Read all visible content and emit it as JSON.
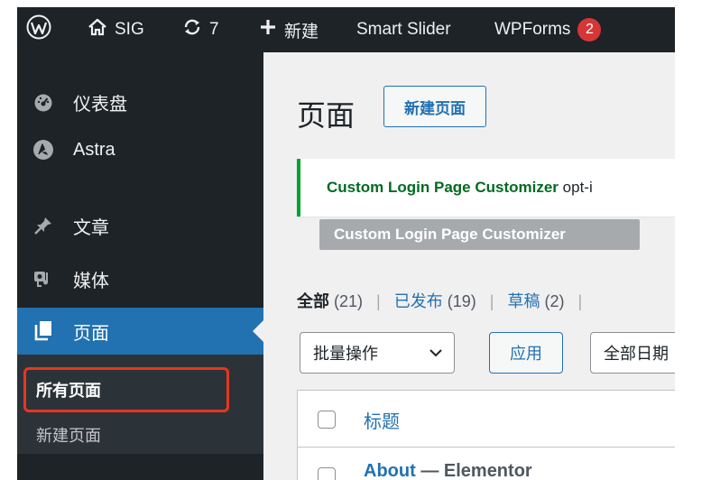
{
  "admin_bar": {
    "site_name": "SIG",
    "updates_count": "7",
    "new_label": "新建",
    "smart_slider_label": "Smart Slider",
    "wpforms_label": "WPForms",
    "wpforms_badge": "2"
  },
  "sidebar": {
    "dashboard": "仪表盘",
    "astra": "Astra",
    "posts": "文章",
    "media": "媒体",
    "pages": "页面",
    "submenu": {
      "all_pages": "所有页面",
      "add_new": "新建页面"
    }
  },
  "main": {
    "page_title": "页面",
    "add_new_button": "新建页面",
    "notice": {
      "plugin_name": "Custom Login Page Customizer",
      "text": "opt-i"
    },
    "notice_button": "Custom Login Page Customizer",
    "filters": {
      "all_label": "全部",
      "all_count": "(21)",
      "published_label": "已发布",
      "published_count": "(19)",
      "draft_label": "草稿",
      "draft_count": "(2)"
    },
    "bulk_actions": "批量操作",
    "apply_button": "应用",
    "date_filter": "全部日期",
    "table": {
      "title_header": "标题",
      "rows": [
        {
          "title": "About",
          "state": "— Elementor"
        }
      ]
    }
  },
  "colors": {
    "admin_bar_bg": "#1d2327",
    "accent": "#2271b1",
    "highlight_border": "#e8361f",
    "badge": "#d63638",
    "notice_border": "#00a32a"
  }
}
